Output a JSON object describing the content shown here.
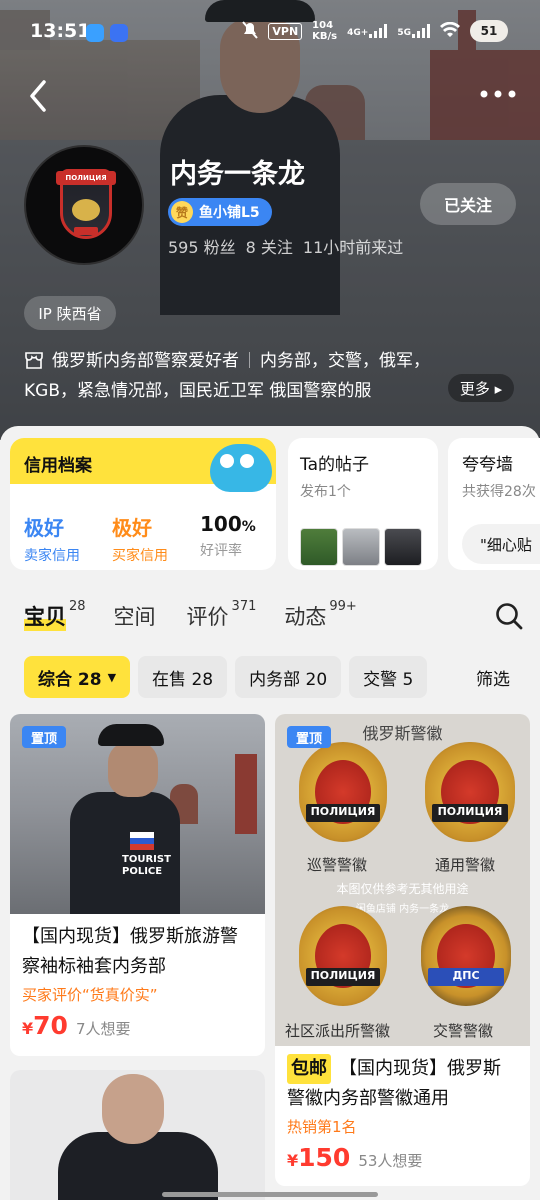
{
  "status_bar": {
    "time": "13:51",
    "vpn": "VPN",
    "speed_top": "104",
    "speed_unit": "KB/s",
    "net1": "4G+",
    "net2": "5G",
    "battery": "51"
  },
  "profile": {
    "name": "内务一条龙",
    "level_icon": "赞",
    "level_label": "鱼小铺L5",
    "fans": "595 粉丝",
    "following": "8 关注",
    "last_seen": "11小时前来过",
    "follow_label": "已关注",
    "ip_label": "IP 陕西省",
    "bio_line1_a": "俄罗斯内务部警察爱好者",
    "bio_line1_b": "内务部，交警，俄军，",
    "bio_line2": "KGB，紧急情况部，国民近卫军 俄国警察的服",
    "more_label": "更多 ▸"
  },
  "credit_card": {
    "title": "信用档案",
    "seller_value": "极好",
    "seller_label": "卖家信用",
    "buyer_value": "极好",
    "buyer_label": "买家信用",
    "rate_value": "100",
    "rate_unit": "%",
    "rate_label": "好评率",
    "colors": {
      "seller": "#3b86f3",
      "buyer": "#ff8c1a"
    }
  },
  "posts_card": {
    "title": "Ta的帖子",
    "sub": "发布1个"
  },
  "praise_card": {
    "title": "夸夸墙",
    "sub": "共获得28次",
    "quote": "\"细心贴"
  },
  "tabs": [
    {
      "label": "宝贝",
      "count": "28"
    },
    {
      "label": "空间",
      "count": ""
    },
    {
      "label": "评价",
      "count": "371"
    },
    {
      "label": "动态",
      "count": "99+"
    }
  ],
  "filters": {
    "chips": [
      "综合 28",
      "在售 28",
      "内务部 20",
      "交警 5"
    ],
    "filter_label": "筛选"
  },
  "products": {
    "p1": {
      "pin": "置顶",
      "title": "【国内现货】俄罗斯旅游警察袖标袖套内务部",
      "tag": "买家评价“货真价实”",
      "currency": "¥",
      "price": "70",
      "want": "7人想要",
      "patch_text1": "TOURIST",
      "patch_text2": "POLICE"
    },
    "p2": {
      "pin": "置顶",
      "img_title": "俄罗斯警徽",
      "badge1": "ПОЛИЦИЯ",
      "badge2": "ПОЛИЦИЯ",
      "badge3": "ПОЛИЦИЯ",
      "badge4": "ДПС",
      "label1": "巡警警徽",
      "label2": "通用警徽",
      "label3": "社区派出所警徽",
      "label4": "交警警徽",
      "watermark": "本图仅供参考无其他用途",
      "watermark2": "闲鱼店铺 内务一条龙",
      "shipping": "包邮",
      "title": "【国内现货】俄罗斯警徽内务部警徽通用",
      "tag": "热销第1名",
      "currency": "¥",
      "price": "150",
      "want": "53人想要"
    }
  }
}
